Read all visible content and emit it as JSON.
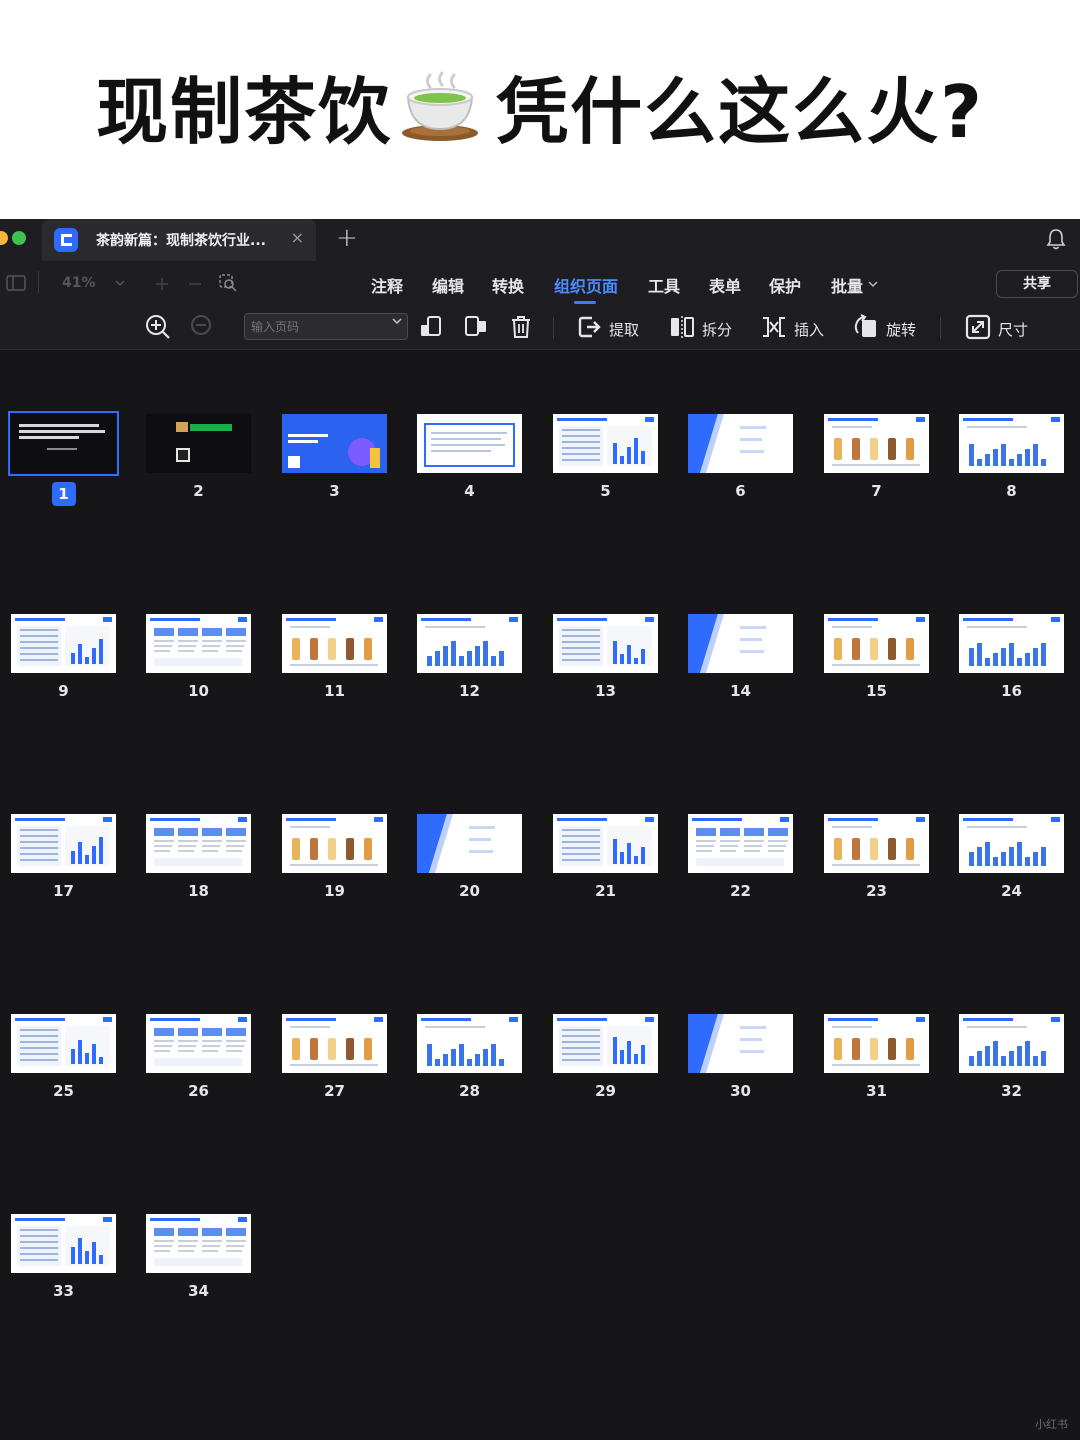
{
  "headline": {
    "before": "现制茶饮",
    "after": "凭什么这么火?",
    "emoji": "teacup-icon"
  },
  "window": {
    "tab_title": "茶韵新篇：现制茶饮行业...",
    "close_glyph": "×",
    "new_tab_glyph": "+"
  },
  "menubar": {
    "zoom": "41%",
    "items": [
      "注释",
      "编辑",
      "转换",
      "组织页面",
      "工具",
      "表单",
      "保护",
      "批量"
    ],
    "active_index": 3,
    "share": "共享"
  },
  "toolbar": {
    "page_input_placeholder": "输入页码",
    "extract": "提取",
    "split": "拆分",
    "insert": "插入",
    "rotate": "旋转",
    "size": "尺寸"
  },
  "pages": {
    "selected": 1,
    "numbers": [
      "1",
      "2",
      "3",
      "4",
      "5",
      "6",
      "7",
      "8",
      "9",
      "10",
      "11",
      "12",
      "13",
      "14",
      "15",
      "16",
      "17",
      "18",
      "19",
      "20",
      "21",
      "22",
      "23",
      "24",
      "25",
      "26",
      "27",
      "28",
      "29",
      "30",
      "31",
      "32",
      "33",
      "34"
    ]
  },
  "watermark": "小红书",
  "colors": {
    "accent": "#2f6bff",
    "background": "#161619",
    "toolbar": "#1e1e22"
  }
}
